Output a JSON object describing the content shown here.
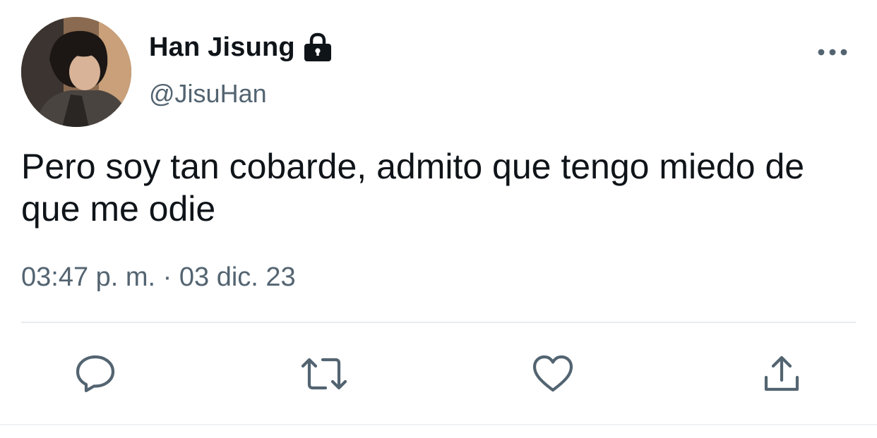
{
  "tweet": {
    "author": {
      "display_name": "Han Jisung",
      "handle": "@JisuHan",
      "protected_icon": "lock-icon",
      "avatar": "profile-photo"
    },
    "text": "Pero soy tan cobarde, admito que tengo miedo de que me odie",
    "timestamp": "03:47 p. m. · 03 dic. 23",
    "more_icon": "ellipsis-icon"
  },
  "actions": [
    {
      "name": "reply",
      "icon": "speech-bubble-icon"
    },
    {
      "name": "retweet",
      "icon": "retweet-icon"
    },
    {
      "name": "like",
      "icon": "heart-icon"
    },
    {
      "name": "share",
      "icon": "share-upload-icon"
    }
  ],
  "colors": {
    "primary_text": "#0f1419",
    "secondary_text": "#536471",
    "icon": "#536471",
    "divider": "#e6ecf0",
    "background": "#ffffff"
  }
}
